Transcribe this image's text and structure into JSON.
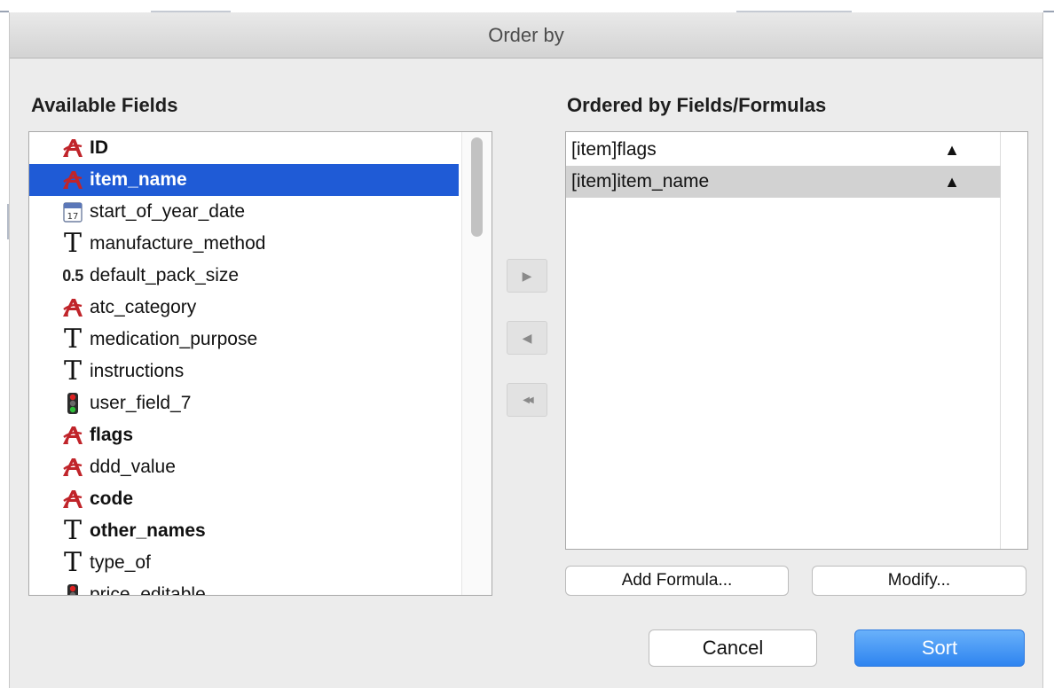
{
  "dialog": {
    "title": "Order by"
  },
  "available": {
    "label": "Available Fields",
    "fields": [
      {
        "name": "ID",
        "icon": "alpha-icon",
        "bold": true,
        "selected": false
      },
      {
        "name": "item_name",
        "icon": "alpha-icon",
        "bold": true,
        "selected": true
      },
      {
        "name": "start_of_year_date",
        "icon": "calendar-icon",
        "bold": false,
        "selected": false
      },
      {
        "name": "manufacture_method",
        "icon": "text-icon",
        "bold": false,
        "selected": false
      },
      {
        "name": "default_pack_size",
        "icon": "number-icon",
        "bold": false,
        "selected": false
      },
      {
        "name": "atc_category",
        "icon": "alpha-icon",
        "bold": false,
        "selected": false
      },
      {
        "name": "medication_purpose",
        "icon": "text-icon",
        "bold": false,
        "selected": false
      },
      {
        "name": "instructions",
        "icon": "text-icon",
        "bold": false,
        "selected": false
      },
      {
        "name": "user_field_7",
        "icon": "boolean-icon",
        "bold": false,
        "selected": false
      },
      {
        "name": "flags",
        "icon": "alpha-icon",
        "bold": true,
        "selected": false
      },
      {
        "name": "ddd_value",
        "icon": "alpha-icon",
        "bold": false,
        "selected": false
      },
      {
        "name": "code",
        "icon": "alpha-icon",
        "bold": true,
        "selected": false
      },
      {
        "name": "other_names",
        "icon": "text-icon",
        "bold": true,
        "selected": false
      },
      {
        "name": "type_of",
        "icon": "text-icon",
        "bold": false,
        "selected": false
      },
      {
        "name": "price_editable",
        "icon": "boolean-icon",
        "bold": false,
        "selected": false
      }
    ],
    "number_icon_text": "0.5",
    "calendar_icon_text": "17"
  },
  "ordered": {
    "label": "Ordered by Fields/Formulas",
    "rows": [
      {
        "name": "[item]flags",
        "direction": "▲",
        "selected": false
      },
      {
        "name": "[item]item_name",
        "direction": "▲",
        "selected": true
      }
    ]
  },
  "move_buttons": {
    "add_glyph": "▶",
    "remove_glyph": "◀",
    "remove_all_glyph": "◀◀"
  },
  "buttons": {
    "add_formula": "Add Formula...",
    "modify": "Modify...",
    "cancel": "Cancel",
    "sort": "Sort"
  },
  "colors": {
    "selection": "#1f5bd6",
    "primary": "#3a8ff3",
    "alpha_icon": "#c0242a"
  }
}
